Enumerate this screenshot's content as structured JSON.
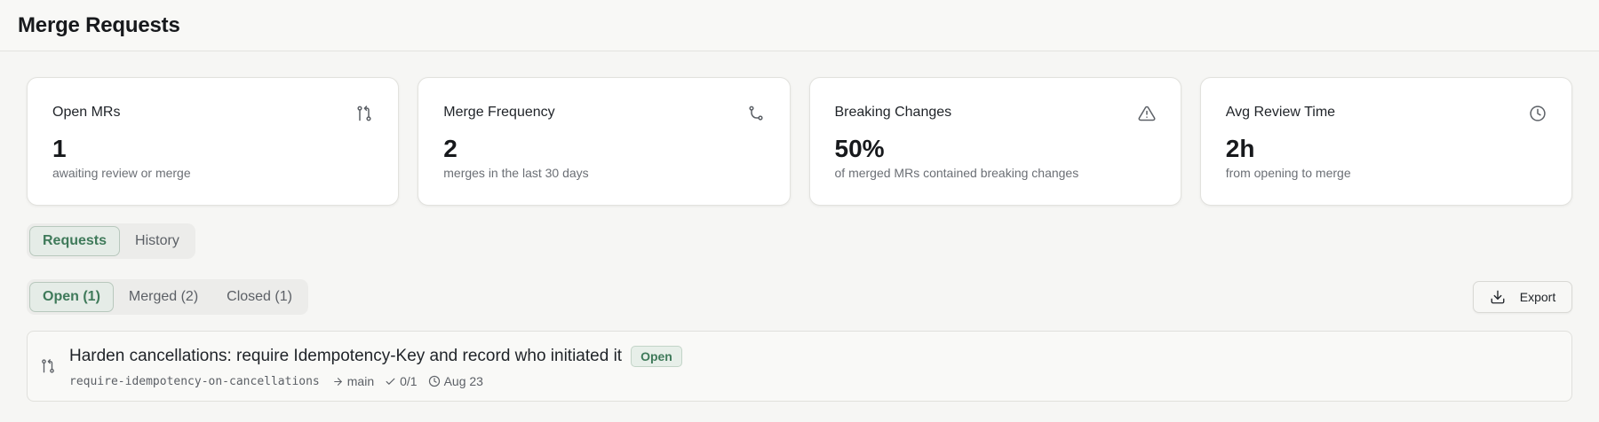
{
  "header": {
    "title": "Merge Requests"
  },
  "stats": [
    {
      "label": "Open MRs",
      "value": "1",
      "sub": "awaiting review or merge",
      "icon": "git-pull-request-icon"
    },
    {
      "label": "Merge Frequency",
      "value": "2",
      "sub": "merges in the last 30 days",
      "icon": "git-merge-icon"
    },
    {
      "label": "Breaking Changes",
      "value": "50%",
      "sub": "of merged MRs contained breaking changes",
      "icon": "alert-triangle-icon"
    },
    {
      "label": "Avg Review Time",
      "value": "2h",
      "sub": "from opening to merge",
      "icon": "clock-icon"
    }
  ],
  "view_tabs": [
    {
      "label": "Requests",
      "active": true
    },
    {
      "label": "History",
      "active": false
    }
  ],
  "filters": [
    {
      "label": "Open (1)",
      "active": true
    },
    {
      "label": "Merged (2)",
      "active": false
    },
    {
      "label": "Closed (1)",
      "active": false
    }
  ],
  "export": {
    "label": "Export",
    "icon": "download-icon"
  },
  "merge_requests": [
    {
      "title": "Harden cancellations: require Idempotency-Key and record who initiated it",
      "status": "Open",
      "branch": "require-idempotency-on-cancellations",
      "target": "main",
      "checks": "0/1",
      "date": "Aug 23"
    }
  ],
  "colors": {
    "accent": "#3f7a5a",
    "accent_bg": "#e5ece7",
    "background": "#f6f6f4"
  }
}
